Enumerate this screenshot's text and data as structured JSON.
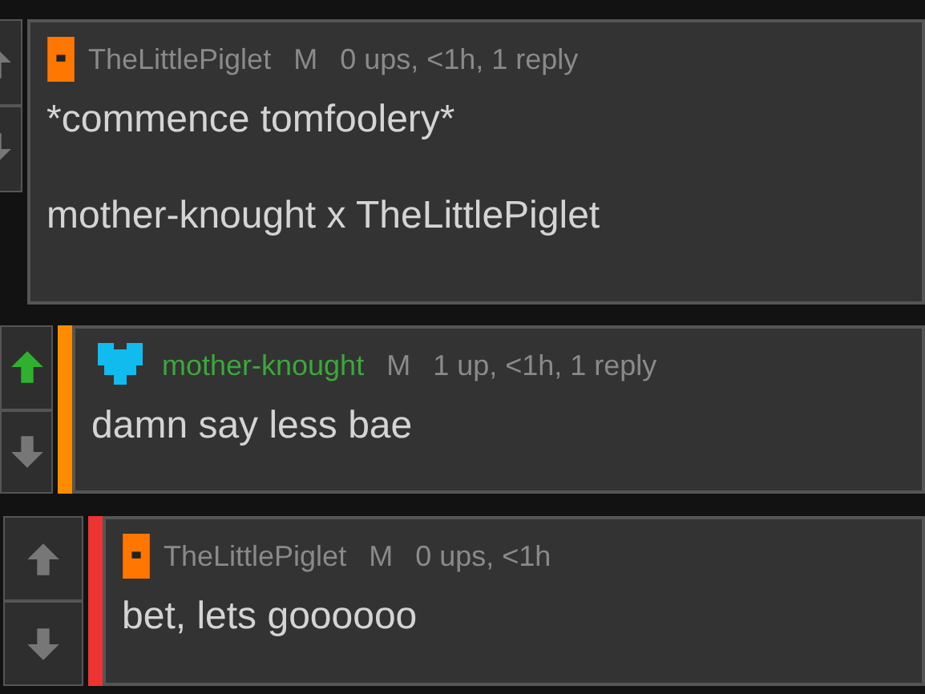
{
  "comments": [
    {
      "kind": "square",
      "username": "TheLittlePiglet",
      "is_op": false,
      "mod_mark": "M",
      "meta": "0 ups, <1h, 1 reply",
      "upvoted": false,
      "body": [
        "*commence tomfoolery*",
        "mother-knought x TheLittlePiglet"
      ],
      "replies": [
        {
          "kind": "heart",
          "username": "mother-knought",
          "is_op": true,
          "mod_mark": "M",
          "meta": "1 up, <1h, 1 reply",
          "upvoted": true,
          "color": "#ff8c00",
          "body": [
            "damn say less bae"
          ],
          "replies": [
            {
              "kind": "square",
              "username": "TheLittlePiglet",
              "is_op": false,
              "mod_mark": "M",
              "meta": "0 ups, <1h",
              "upvoted": false,
              "color": "#ee3333",
              "body": [
                "bet, lets goooooo"
              ]
            }
          ]
        }
      ]
    }
  ]
}
